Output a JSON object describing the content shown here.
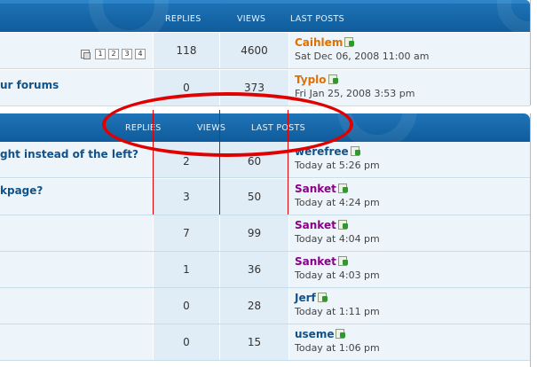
{
  "top_header": {
    "replies": "REPLIES",
    "views": "VIEWS",
    "last_posts": "LAST POSTS"
  },
  "top_rows": [
    {
      "title": "",
      "pages": [
        "1",
        "2",
        "3",
        "4"
      ],
      "replies": "118",
      "views": "4600",
      "user": "Caihlem",
      "user_color": "#e07000",
      "date": "Sat Dec 06, 2008 11:00 am"
    },
    {
      "title": "ur forums",
      "replies": "0",
      "views": "373",
      "user": "Typlo",
      "user_color": "#e07000",
      "date": "Fri Jan 25, 2008 3:53 pm"
    }
  ],
  "bottom_header": {
    "replies": "REPLIES",
    "views": "VIEWS",
    "last_posts": "LAST POSTS"
  },
  "bottom_rows": [
    {
      "title": "ght instead of the left?",
      "replies": "2",
      "views": "60",
      "user": "werefree",
      "date": "Today at 5:26 pm"
    },
    {
      "title": "kpage?",
      "replies": "3",
      "views": "50",
      "user": "Sanket",
      "date": "Today at 4:24 pm"
    },
    {
      "title": "",
      "replies": "7",
      "views": "99",
      "user": "Sanket",
      "date": "Today at 4:04 pm"
    },
    {
      "title": "",
      "replies": "1",
      "views": "36",
      "user": "Sanket",
      "date": "Today at 4:03 pm"
    },
    {
      "title": "",
      "replies": "0",
      "views": "28",
      "user": "Jerf",
      "date": "Today at 1:11 pm"
    },
    {
      "title": "",
      "replies": "0",
      "views": "15",
      "user": "useme",
      "date": "Today at 1:06 pm"
    }
  ],
  "colors": {
    "header_blue": "#0f5c9c",
    "link_blue": "#105289",
    "annotation_red": "#e00000"
  }
}
